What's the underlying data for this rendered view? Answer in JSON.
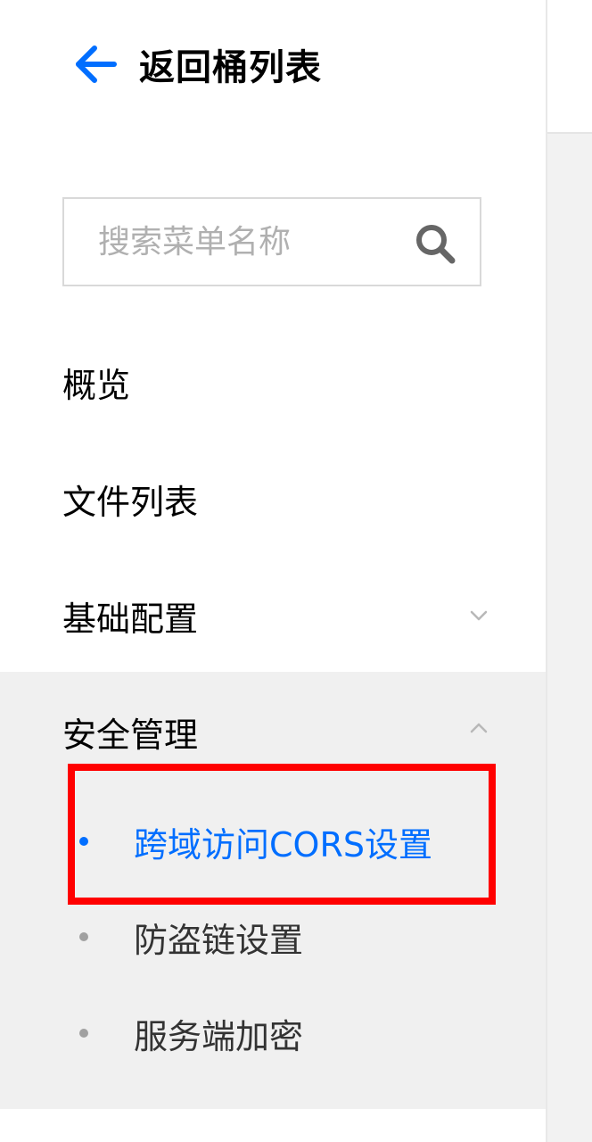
{
  "header": {
    "back_label": "返回桶列表"
  },
  "search": {
    "placeholder": "搜索菜单名称"
  },
  "menu": {
    "items": [
      {
        "label": "概览"
      },
      {
        "label": "文件列表"
      },
      {
        "label": "基础配置",
        "expanded": false
      },
      {
        "label": "安全管理",
        "expanded": true
      }
    ],
    "security_sub_items": [
      {
        "label": "跨域访问CORS设置",
        "active": true
      },
      {
        "label": "防盗链设置",
        "active": false
      },
      {
        "label": "服务端加密",
        "active": false
      }
    ]
  },
  "colors": {
    "accent": "#006eff",
    "highlight": "#ff0000",
    "group_background": "#f0f0f0"
  },
  "icons": {
    "back": "arrow-left-icon",
    "search": "search-icon",
    "collapse": "chevron-down-icon",
    "expand": "chevron-up-icon"
  }
}
